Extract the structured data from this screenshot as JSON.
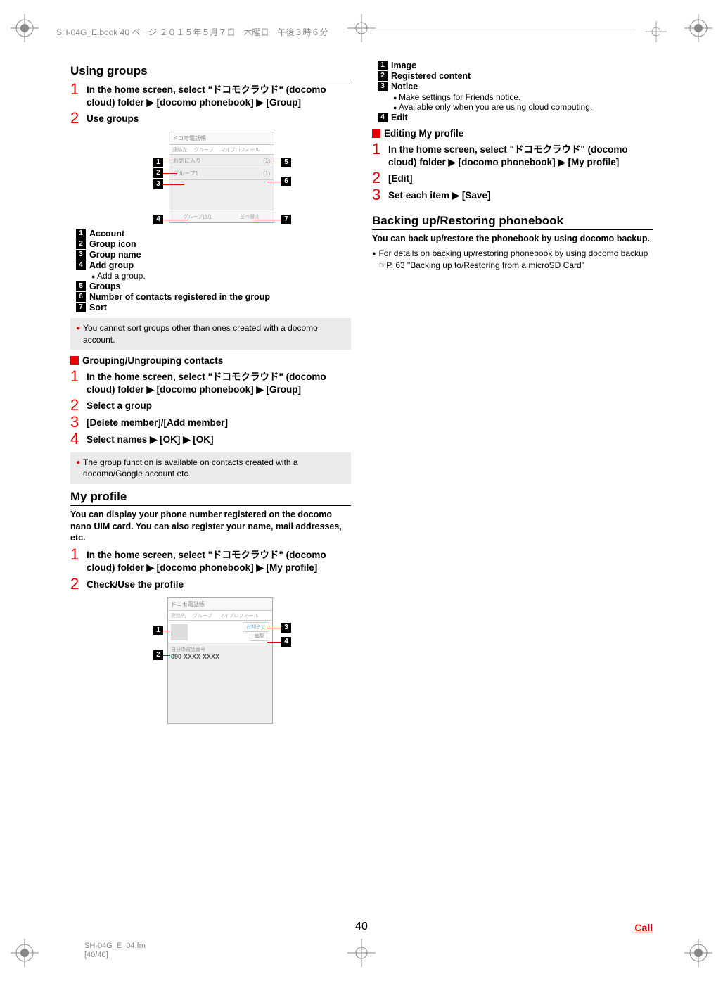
{
  "header": {
    "book_info": "SH-04G_E.book  40 ページ  ２０１５年５月７日　木曜日　午後３時６分"
  },
  "left_col": {
    "section1_title": "Using groups",
    "step1": "In the home screen, select \"ドコモクラウド\" (docomo cloud) folder ▶ [docomo phonebook] ▶ [Group]",
    "step2": "Use groups",
    "ss1": {
      "header": "ドコモ電話帳",
      "tab1": "連絡先",
      "tab2": "グループ",
      "tab3": "マイプロフィール",
      "row1_label": "お気に入り",
      "row1_count": "(1)",
      "row2_label": "グループ1",
      "row2_count": "(1)",
      "footer1": "グループ追加",
      "footer2": "並べ替え"
    },
    "legend1": [
      {
        "n": "1",
        "t": "Account"
      },
      {
        "n": "2",
        "t": "Group icon"
      },
      {
        "n": "3",
        "t": "Group name"
      },
      {
        "n": "4",
        "t": "Add group",
        "sub": "Add a group."
      },
      {
        "n": "5",
        "t": "Groups"
      },
      {
        "n": "6",
        "t": "Number of contacts registered in the group"
      },
      {
        "n": "7",
        "t": "Sort"
      }
    ],
    "note1": "You cannot sort groups other than ones created with a docomo account.",
    "subheading1": "Grouping/Ungrouping contacts",
    "g_step1": "In the home screen, select \"ドコモクラウド\" (docomo cloud) folder ▶ [docomo phonebook] ▶ [Group]",
    "g_step2": "Select a group",
    "g_step3": "[Delete member]/[Add member]",
    "g_step4": "Select names ▶ [OK] ▶ [OK]",
    "note2": "The group function is available on contacts created with a docomo/Google account etc.",
    "section2_title": "My profile",
    "section2_desc": "You can display your phone number registered on the docomo nano UIM card. You can also register your name, mail addresses, etc.",
    "mp_step1": "In the home screen, select \"ドコモクラウド\" (docomo cloud) folder ▶ [docomo phonebook] ▶ [My profile]",
    "mp_step2": "Check/Use the profile",
    "ss2": {
      "header": "ドコモ電話帳",
      "tab1": "連絡先",
      "tab2": "グループ",
      "tab3": "マイプロフィール",
      "edit_btn": "編集",
      "phone_label": "自分の電話番号",
      "phone_value": "090-XXXX-XXXX"
    }
  },
  "right_col": {
    "legend2": [
      {
        "n": "1",
        "t": "Image"
      },
      {
        "n": "2",
        "t": "Registered content"
      },
      {
        "n": "3",
        "t": "Notice",
        "subs": [
          "Make settings for Friends notice.",
          "Available only when you are using cloud computing."
        ]
      },
      {
        "n": "4",
        "t": "Edit"
      }
    ],
    "subheading1": "Editing My profile",
    "e_step1": "In the home screen, select \"ドコモクラウド\" (docomo cloud) folder ▶ [docomo phonebook] ▶ [My profile]",
    "e_step2": "[Edit]",
    "e_step3": "Set each item ▶ [Save]",
    "section3_title": "Backing up/Restoring phonebook",
    "section3_desc": "You can back up/restore the phonebook by using docomo backup.",
    "section3_bullet": "For details on backing up/restoring phonebook by using docomo backup ☞P. 63 \"Backing up to/Restoring from a microSD Card\""
  },
  "footer": {
    "page_num": "40",
    "link": "Call",
    "meta1": "SH-04G_E_04.fm",
    "meta2": "[40/40]"
  }
}
